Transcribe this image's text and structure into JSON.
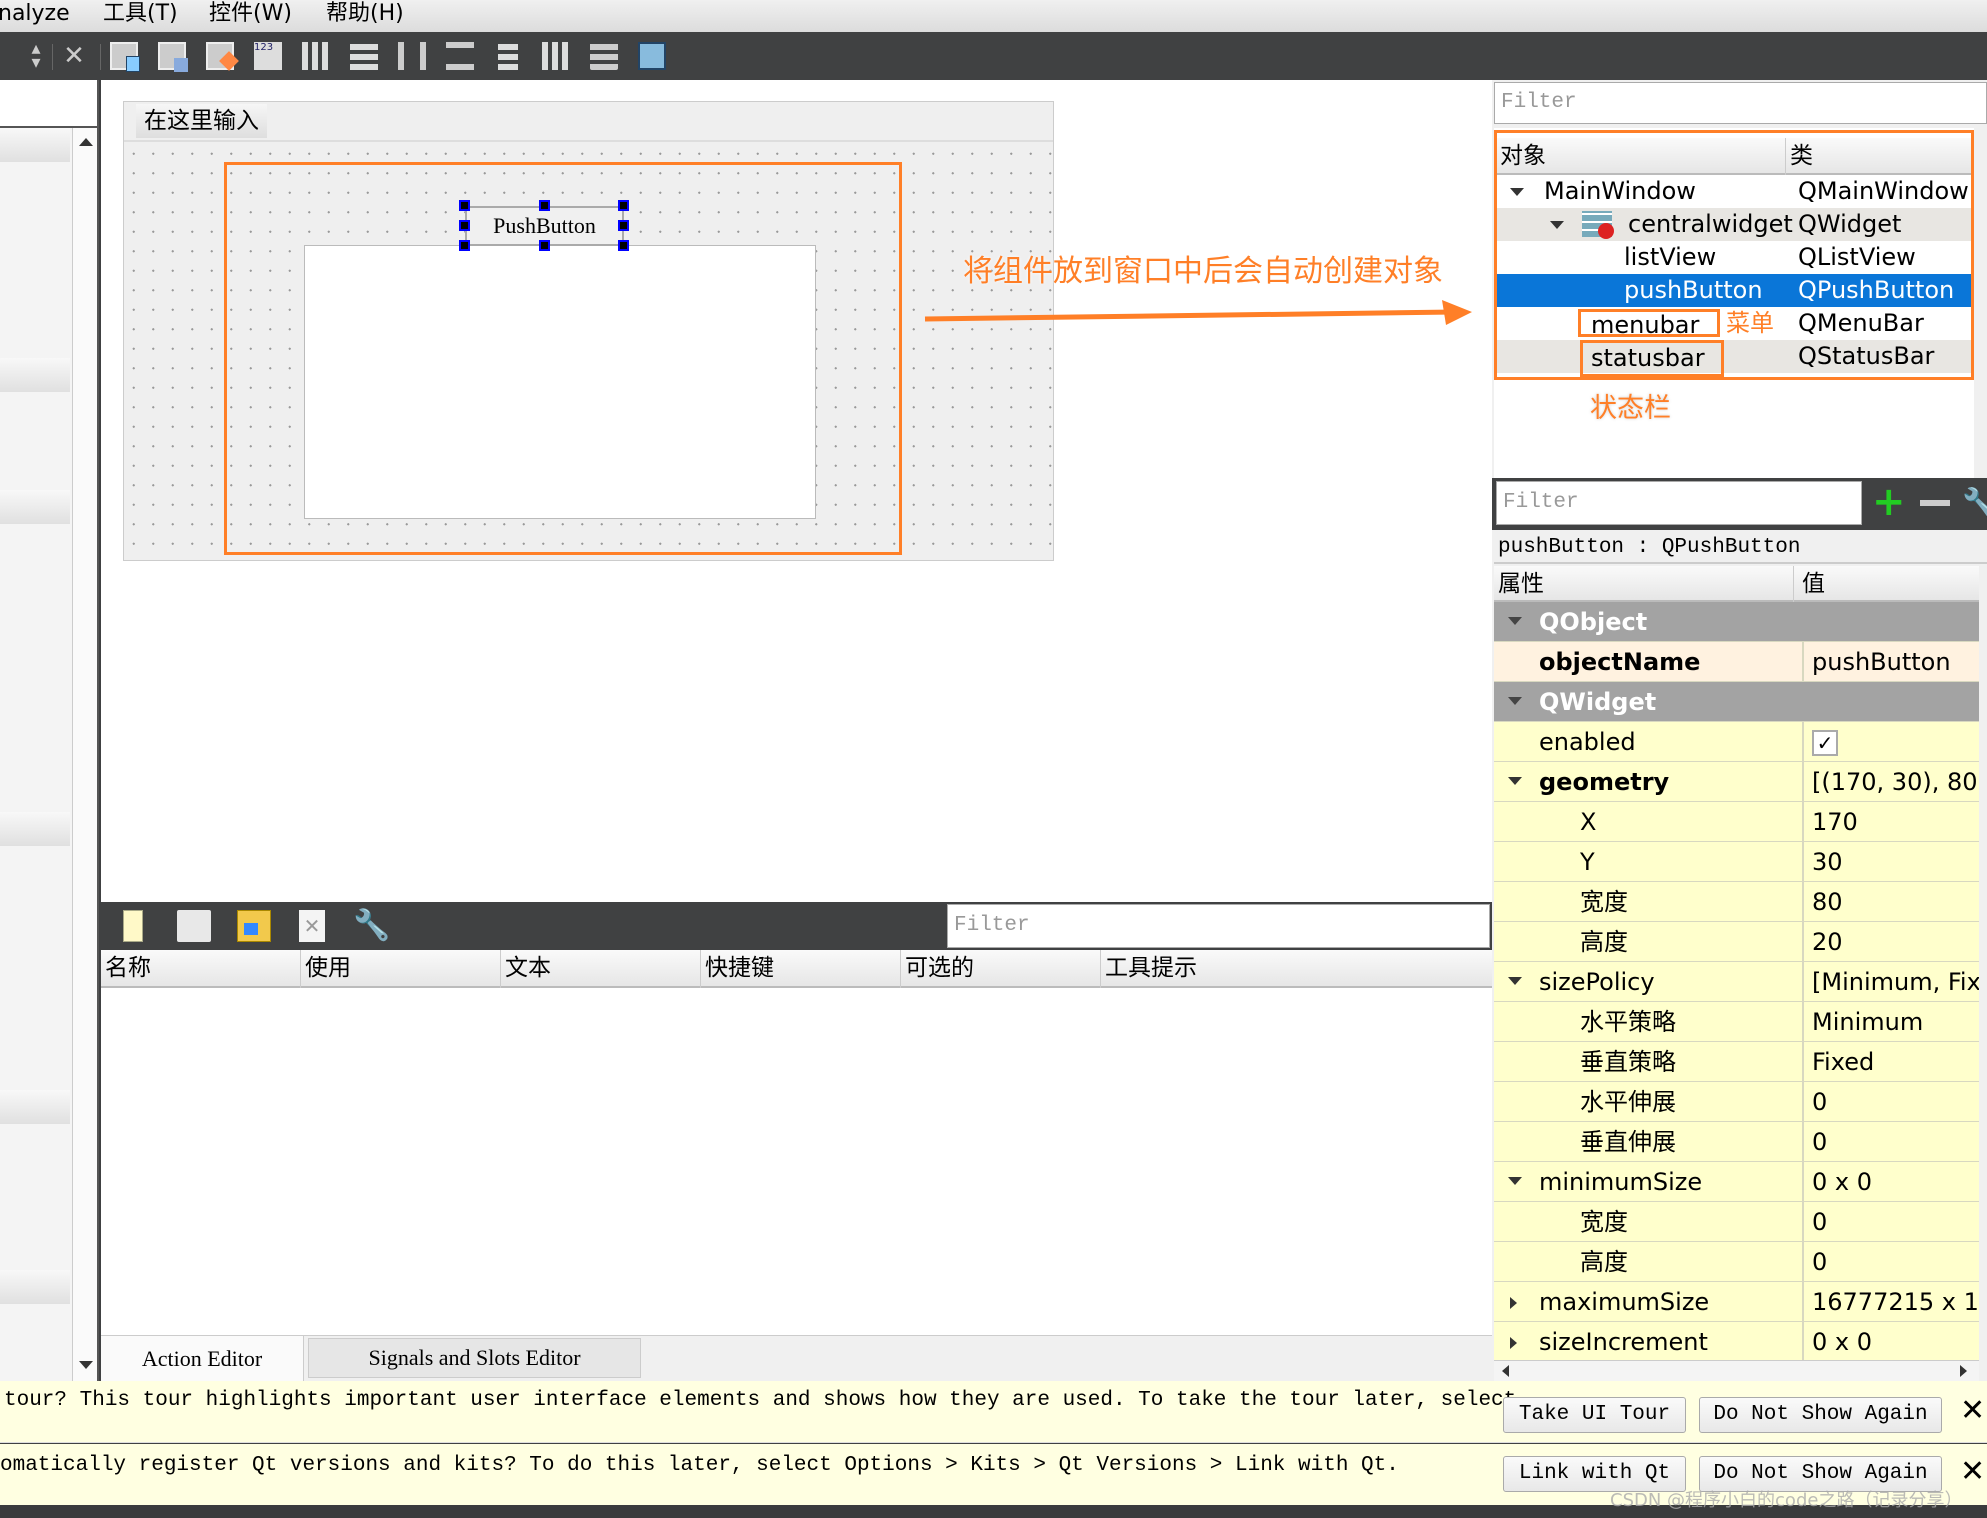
{
  "menu": [
    "nalyze",
    "工具(T)",
    "控件(W)",
    "帮助(H)"
  ],
  "toolbar_icons": [
    "sort-arrows-icon",
    "close-icon",
    "edit-widgets-icon",
    "edit-signals-slots-icon",
    "edit-buddies-icon",
    "edit-tab-order-icon",
    "layout-horizontal-icon",
    "layout-vertical-icon",
    "layout-h-splitter-icon",
    "layout-v-splitter-icon",
    "layout-form-icon",
    "layout-grid-icon",
    "break-layout-icon",
    "adjust-size-icon"
  ],
  "form": {
    "menu_placeholder": "在这里输入",
    "push_button": "PushButton"
  },
  "annotations": {
    "auto_create": "将组件放到窗口中后会自动创建对象",
    "menubar": "菜单",
    "statusbar": "状态栏",
    "accent": "#ff7f27"
  },
  "object_inspector": {
    "filter_placeholder": "Filter",
    "headers": [
      "对象",
      "类"
    ],
    "rows": [
      {
        "name": "MainWindow",
        "class": "QMainWindow"
      },
      {
        "name": "centralwidget",
        "class": "QWidget"
      },
      {
        "name": "listView",
        "class": "QListView"
      },
      {
        "name": "pushButton",
        "class": "QPushButton",
        "selected": true
      },
      {
        "name": "menubar",
        "class": "QMenuBar"
      },
      {
        "name": "statusbar",
        "class": "QStatusBar"
      }
    ]
  },
  "property_editor": {
    "filter_placeholder": "Filter",
    "object_label": "pushButton : QPushButton",
    "headers": [
      "属性",
      "值"
    ],
    "rows": [
      {
        "name": "QObject",
        "value": "",
        "type": "group"
      },
      {
        "name": "objectName",
        "value": "pushButton",
        "type": "bold"
      },
      {
        "name": "QWidget",
        "value": "",
        "type": "group"
      },
      {
        "name": "enabled",
        "value": "",
        "checked": true
      },
      {
        "name": "geometry",
        "value": "[(170, 30), 80 x...",
        "type": "bold",
        "expand": "open"
      },
      {
        "name": "X",
        "value": "170",
        "level": 1
      },
      {
        "name": "Y",
        "value": "30",
        "level": 1
      },
      {
        "name": "宽度",
        "value": "80",
        "level": 1
      },
      {
        "name": "高度",
        "value": "20",
        "level": 1
      },
      {
        "name": "sizePolicy",
        "value": "[Minimum, Fix...",
        "expand": "open"
      },
      {
        "name": "水平策略",
        "value": "Minimum",
        "level": 1
      },
      {
        "name": "垂直策略",
        "value": "Fixed",
        "level": 1
      },
      {
        "name": "水平伸展",
        "value": "0",
        "level": 1
      },
      {
        "name": "垂直伸展",
        "value": "0",
        "level": 1
      },
      {
        "name": "minimumSize",
        "value": "0 x 0",
        "expand": "open"
      },
      {
        "name": "宽度",
        "value": "0",
        "level": 1
      },
      {
        "name": "高度",
        "value": "0",
        "level": 1
      },
      {
        "name": "maximumSize",
        "value": "16777215 x 16...",
        "expand": "closed"
      },
      {
        "name": "sizeIncrement",
        "value": "0 x 0",
        "expand": "closed"
      }
    ]
  },
  "action_editor": {
    "filter_placeholder": "Filter",
    "columns": [
      "名称",
      "使用",
      "文本",
      "快捷键",
      "可选的",
      "工具提示"
    ],
    "tabs": [
      "Action Editor",
      "Signals and Slots Editor"
    ]
  },
  "info_bars": [
    {
      "text": "tour? This tour highlights important user interface elements and shows how they are used. To take the tour later, select",
      "primary": "Take UI Tour",
      "secondary": "Do Not Show Again"
    },
    {
      "text": "omatically register Qt versions and kits? To do this later, select Options > Kits > Qt Versions > Link with Qt.",
      "primary": "Link with Qt",
      "secondary": "Do Not Show Again"
    }
  ],
  "watermark": "CSDN @程序小白的code之路（记录分享）"
}
